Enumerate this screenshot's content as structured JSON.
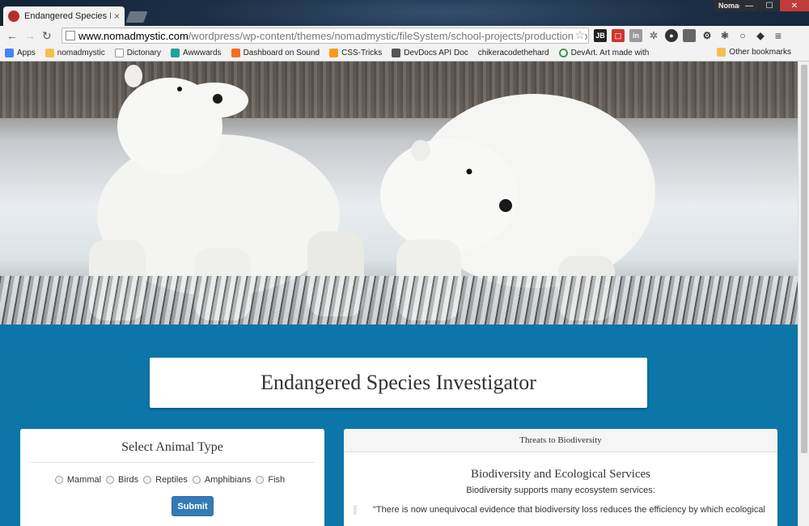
{
  "browser": {
    "tab_title": "Endangered Species Inves",
    "tab_close": "×",
    "profile_name": "Nomad",
    "url_host": "www.nomadmystic.com",
    "url_path": "/wordpress/wp-content/themes/nomadmystic/fileSystem/school-projects/production/comp",
    "bookmarks": [
      "Apps",
      "nomadmystic",
      "Dictonary",
      "Awwwards",
      "Dashboard on Sound",
      "CSS-Tricks",
      "DevDocs API Doc",
      "chikeracodethehard",
      "DevArt. Art made with"
    ],
    "other_bookmarks": "Other bookmarks"
  },
  "page": {
    "title": "Endangered Species Investigator",
    "select_panel": {
      "heading": "Select Animal Type",
      "options": [
        "Mammal",
        "Birds",
        "Reptiles",
        "Amphibians",
        "Fish"
      ],
      "submit_label": "Submit"
    },
    "threats_panel": {
      "heading": "Threats to Biodiversity",
      "subheading": "Biodiversity and Ecological Services",
      "lead": "Biodiversity supports many ecosystem services:",
      "quote": "\"There is now unequivocal evidence that biodiversity loss reduces the efficiency by which ecological"
    }
  },
  "colors": {
    "page_bg": "#0c76a8",
    "button": "#337ab7"
  }
}
